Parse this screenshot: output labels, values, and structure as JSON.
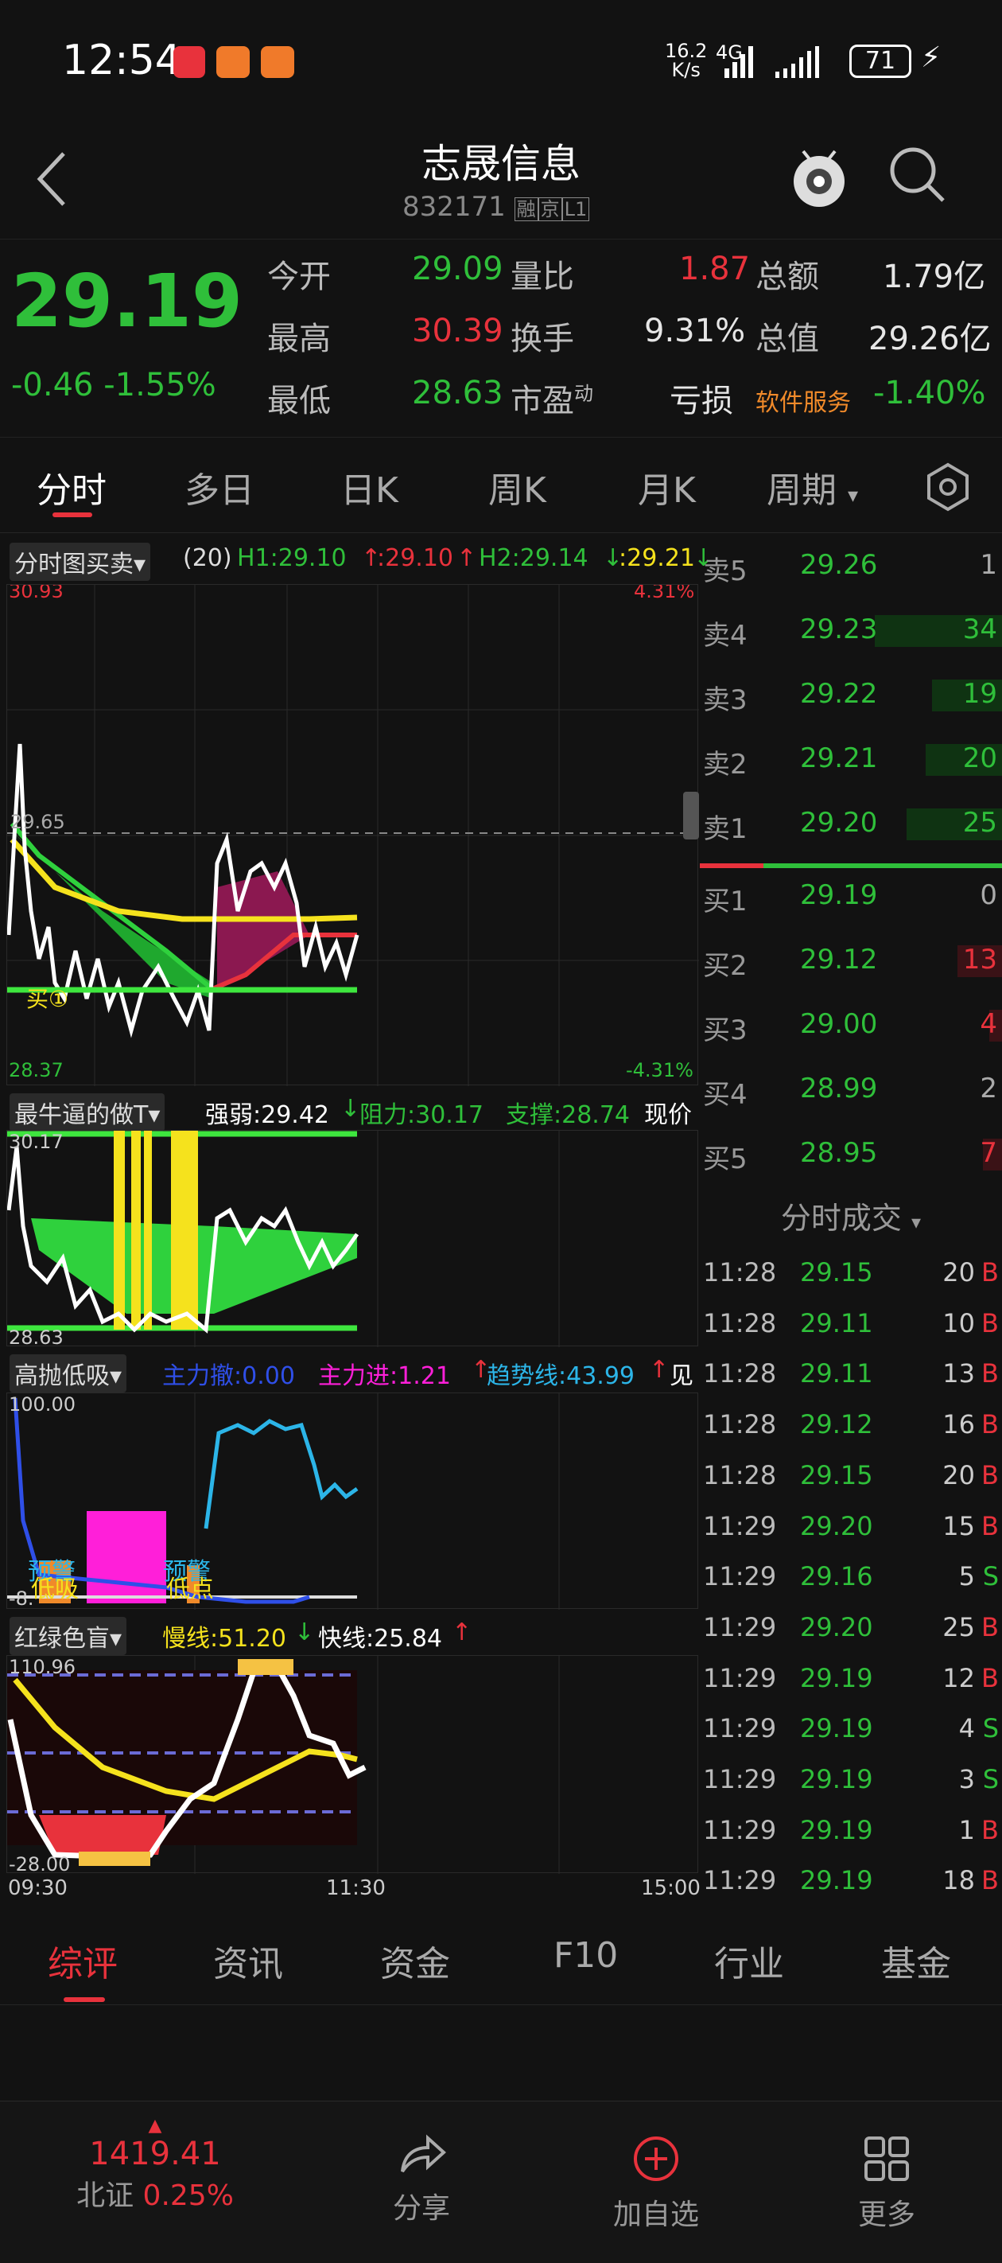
{
  "status": {
    "time": "12:54",
    "net_speed_top": "16.2",
    "net_speed_bottom": "K/s",
    "network": "4G",
    "battery": "71"
  },
  "header": {
    "title": "志晟信息",
    "code": "832171",
    "tag1": "融",
    "tag2": "京",
    "tag3": "L1"
  },
  "quote": {
    "price": "29.19",
    "change": "-0.46",
    "change_pct": "-1.55%",
    "open_label": "今开",
    "open": "29.09",
    "high_label": "最高",
    "high": "30.39",
    "low_label": "最低",
    "low": "28.63",
    "vr_label": "量比",
    "vr": "1.87",
    "turnover_label": "换手",
    "turnover": "9.31%",
    "pe_label": "市盈",
    "pe_sup": "动",
    "pe": "亏损",
    "amount_label": "总额",
    "amount": "1.79亿",
    "mcap_label": "总值",
    "mcap": "29.26亿",
    "sector": "软件服务",
    "sector_pct": "-1.40%"
  },
  "tabs": [
    "分时",
    "多日",
    "日K",
    "周K",
    "月K",
    "周期"
  ],
  "p1": {
    "name": "分时图买卖",
    "param": "(20)",
    "h1": "H1:29.10",
    "h1b": ":29.10",
    "h2": "H2:29.14",
    "h2b": ":29.21",
    "top": "30.93",
    "top_pct": "4.31%",
    "mid": "29.65",
    "bot": "28.37",
    "bot_pct": "-4.31%",
    "buy_mark": "买①"
  },
  "p2": {
    "name": "最牛逼的做T",
    "weak": "强弱:29.42",
    "resist": "阻力:30.17",
    "support": "支撑:28.74",
    "cur": "现价",
    "top": "30.17",
    "bot": "28.63"
  },
  "p3": {
    "name": "高抛低吸",
    "main_out": "主力撤:0.00",
    "main_in": "主力进:1.21",
    "trend": "趋势线:43.99",
    "see": "见",
    "top": "100.00",
    "bot": "-8.",
    "lbl1": "预警",
    "lbl2": "低吸",
    "lbl3": "预警",
    "lbl4": "低点"
  },
  "p4": {
    "name": "红绿色盲",
    "slow": "慢线:51.20",
    "fast": "快线:25.84",
    "top": "110.96",
    "bot": "-28.00"
  },
  "axis": {
    "t0": "09:30",
    "t1": "11:30",
    "t2": "15:00"
  },
  "orderbook": [
    {
      "label": "卖5",
      "price": "29.26",
      "vol": "1",
      "bar": 0
    },
    {
      "label": "卖4",
      "price": "29.23",
      "vol": "34",
      "bar": 1
    },
    {
      "label": "卖3",
      "price": "29.22",
      "vol": "19",
      "bar": 0.55
    },
    {
      "label": "卖2",
      "price": "29.21",
      "vol": "20",
      "bar": 0.6
    },
    {
      "label": "卖1",
      "price": "29.20",
      "vol": "25",
      "bar": 0.75
    },
    {
      "label": "买1",
      "price": "29.19",
      "vol": "0",
      "bar": 0
    },
    {
      "label": "买2",
      "price": "29.12",
      "vol": "13",
      "bar": 0.35
    },
    {
      "label": "买3",
      "price": "29.00",
      "vol": "4",
      "bar": 0.1
    },
    {
      "label": "买4",
      "price": "28.99",
      "vol": "2",
      "bar": 0
    },
    {
      "label": "买5",
      "price": "28.95",
      "vol": "7",
      "bar": 0.15
    }
  ],
  "trades_title": "分时成交",
  "trades": [
    {
      "t": "11:28",
      "p": "29.15",
      "v": "20",
      "s": "B"
    },
    {
      "t": "11:28",
      "p": "29.11",
      "v": "10",
      "s": "B"
    },
    {
      "t": "11:28",
      "p": "29.11",
      "v": "13",
      "s": "B"
    },
    {
      "t": "11:28",
      "p": "29.12",
      "v": "16",
      "s": "B"
    },
    {
      "t": "11:28",
      "p": "29.15",
      "v": "20",
      "s": "B"
    },
    {
      "t": "11:29",
      "p": "29.20",
      "v": "15",
      "s": "B"
    },
    {
      "t": "11:29",
      "p": "29.16",
      "v": "5",
      "s": "S"
    },
    {
      "t": "11:29",
      "p": "29.20",
      "v": "25",
      "s": "B"
    },
    {
      "t": "11:29",
      "p": "29.19",
      "v": "12",
      "s": "B"
    },
    {
      "t": "11:29",
      "p": "29.19",
      "v": "4",
      "s": "S"
    },
    {
      "t": "11:29",
      "p": "29.19",
      "v": "3",
      "s": "S"
    },
    {
      "t": "11:29",
      "p": "29.19",
      "v": "1",
      "s": "B"
    },
    {
      "t": "11:29",
      "p": "29.19",
      "v": "18",
      "s": "B"
    }
  ],
  "btabs": [
    "综评",
    "资讯",
    "资金",
    "F10",
    "行业",
    "基金"
  ],
  "bottom": {
    "index": "1419.41",
    "index_name": "北证",
    "index_pct": "0.25%",
    "share": "分享",
    "add": "加自选",
    "more": "更多"
  },
  "colors": {
    "up": "#e8323c",
    "down": "#2fbf3a",
    "yellow": "#f5e21d",
    "magenta": "#ff1fd9",
    "cyan": "#2cb5e8",
    "accent": "#e8323c"
  }
}
